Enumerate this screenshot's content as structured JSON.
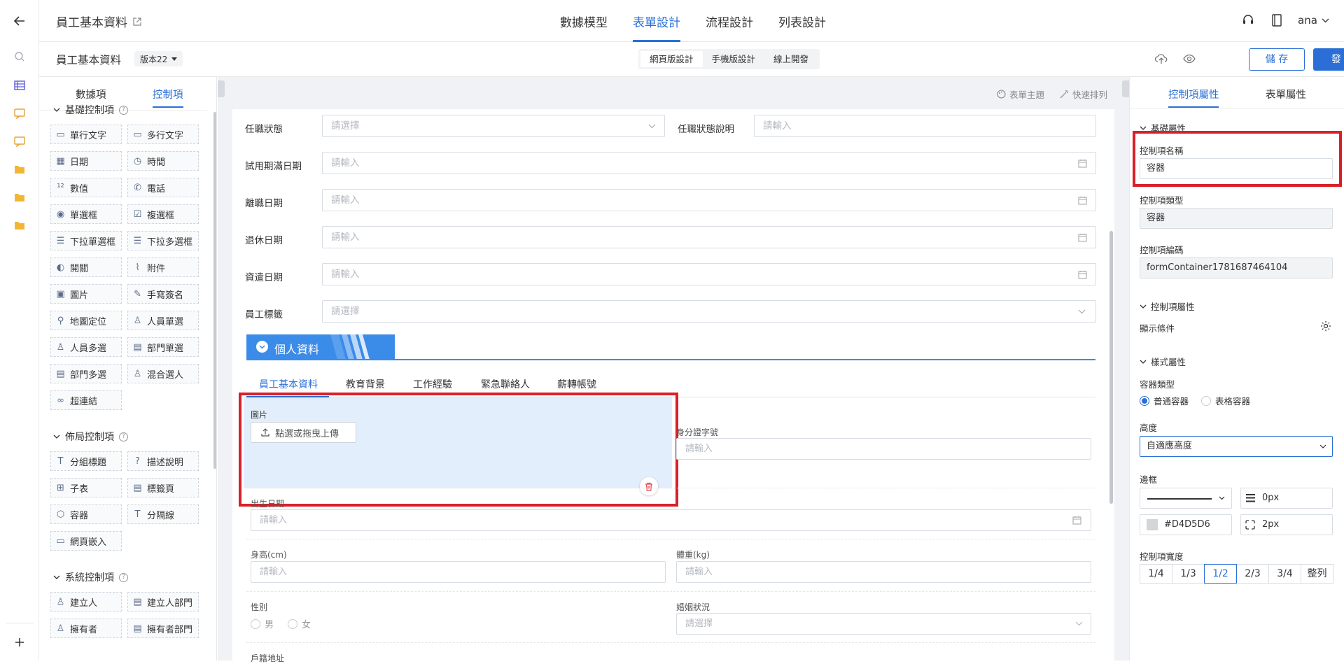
{
  "app": {
    "title": "員工基本資料",
    "top_tabs": [
      "數據模型",
      "表單設計",
      "流程設計",
      "列表設計"
    ],
    "active_top_tab": 1,
    "user": "ana"
  },
  "toolbar": {
    "form_name": "員工基本資料",
    "version": "版本22",
    "modes": [
      "網頁版設計",
      "手機版設計",
      "線上開發"
    ],
    "active_mode": 0,
    "save_label": "儲 存",
    "publish_label": "發 布"
  },
  "left_panel": {
    "tabs": [
      "數據項",
      "控制項"
    ],
    "groups": [
      {
        "title": "基礎控制項",
        "items": [
          [
            "單行文字",
            "rect"
          ],
          [
            "多行文字",
            "rect"
          ],
          [
            "日期",
            "cal"
          ],
          [
            "時間",
            "clock"
          ],
          [
            "數值",
            "num"
          ],
          [
            "電話",
            "phone"
          ],
          [
            "單選框",
            "radio"
          ],
          [
            "複選框",
            "check"
          ],
          [
            "下拉單選框",
            "list"
          ],
          [
            "下拉多選框",
            "list"
          ],
          [
            "開關",
            "toggle"
          ],
          [
            "附件",
            "clip"
          ],
          [
            "圖片",
            "image"
          ],
          [
            "手寫簽名",
            "pen"
          ],
          [
            "地圖定位",
            "pin"
          ],
          [
            "人員單選",
            "user"
          ],
          [
            "人員多選",
            "users"
          ],
          [
            "部門單選",
            "dept"
          ],
          [
            "部門多選",
            "dept"
          ],
          [
            "混合選人",
            "users"
          ],
          [
            "超連結",
            "link"
          ]
        ]
      },
      {
        "title": "佈局控制項",
        "items": [
          [
            "分組標題",
            "T"
          ],
          [
            "描述說明",
            "help"
          ],
          [
            "子表",
            "grid"
          ],
          [
            "標籤頁",
            "tab"
          ],
          [
            "容器",
            "cube"
          ],
          [
            "分隔線",
            "T"
          ],
          [
            "網頁嵌入",
            "web"
          ]
        ]
      },
      {
        "title": "系統控制項",
        "items": [
          [
            "建立人",
            "user"
          ],
          [
            "建立人部門",
            "dept"
          ],
          [
            "擁有者",
            "user"
          ],
          [
            "擁有者部門",
            "dept"
          ]
        ]
      }
    ]
  },
  "canvas": {
    "topbar": [
      "表單主題",
      "快速排列"
    ],
    "rows": [
      {
        "label": "任職狀態",
        "placeholder": "請選擇",
        "type": "select",
        "label2": "任職狀態說明",
        "placeholder2": "請輸入"
      },
      {
        "label": "試用期滿日期",
        "placeholder": "請輸入",
        "type": "date"
      },
      {
        "label": "離職日期",
        "placeholder": "請輸入",
        "type": "date"
      },
      {
        "label": "退休日期",
        "placeholder": "請輸入",
        "type": "date"
      },
      {
        "label": "資遣日期",
        "placeholder": "請輸入",
        "type": "date"
      },
      {
        "label": "員工標籤",
        "placeholder": "請選擇",
        "type": "select"
      }
    ],
    "section_title": "個人資料",
    "sub_tabs": [
      "員工基本資料",
      "教育背景",
      "工作經驗",
      "緊急聯絡人",
      "薪轉帳號"
    ],
    "image_field": {
      "label": "圖片",
      "button": "點選或拖曳上傳"
    },
    "id_field": {
      "label": "身分證字號",
      "placeholder": "請輸入"
    },
    "birth_field": {
      "label": "出生日期",
      "placeholder": "請輸入"
    },
    "height_field": {
      "label": "身高(cm)",
      "placeholder": "請輸入"
    },
    "weight_field": {
      "label": "體重(kg)",
      "placeholder": "請輸入"
    },
    "gender_field": {
      "label": "性別",
      "options": [
        "男",
        "女"
      ]
    },
    "marital_field": {
      "label": "婚姻狀況",
      "placeholder": "請選擇"
    },
    "address_field": {
      "label": "戶籍地址"
    }
  },
  "right_panel": {
    "tabs": [
      "控制項屬性",
      "表單屬性"
    ],
    "basic_title": "基礎屬性",
    "name_label": "控制項名稱",
    "name_value": "容器",
    "type_label": "控制項類型",
    "type_value": "容器",
    "code_label": "控制項編碼",
    "code_value": "formContainer1781687464104",
    "ctrl_attr_title": "控制項屬性",
    "display_cond": "顯示條件",
    "style_title": "樣式屬性",
    "container_type_label": "容器類型",
    "container_types": [
      "普通容器",
      "表格容器"
    ],
    "height_label": "高度",
    "height_value": "自適應高度",
    "border_label": "邊框",
    "border_width": "0px",
    "border_color": "#D4D5D6",
    "radius": "2px",
    "width_label": "控制項寬度",
    "widths": [
      "1/4",
      "1/3",
      "1/2",
      "2/3",
      "3/4",
      "整列"
    ],
    "active_width": 2
  }
}
